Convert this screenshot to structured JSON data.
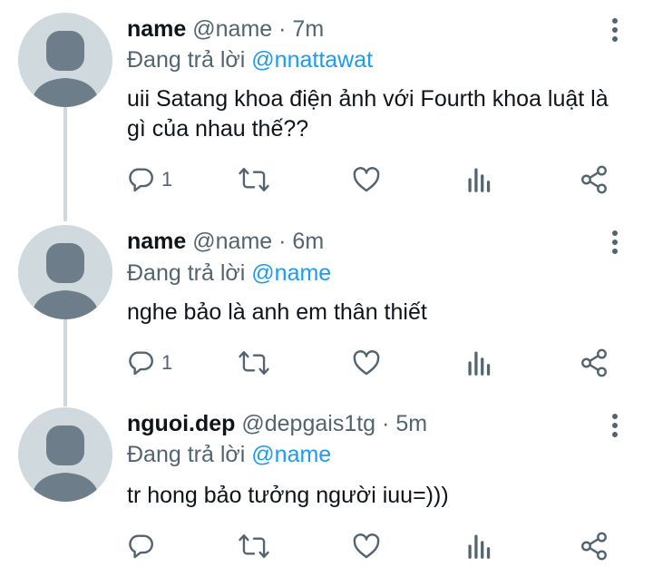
{
  "tweets": [
    {
      "name": "name",
      "handle": "@name",
      "time": "7m",
      "replying_prefix": "Đang trả lời",
      "replying_to": "@nnattawat",
      "text": "uii Satang khoa điện ảnh với Fourth khoa luật là gì của nhau thế??",
      "reply_count": "1"
    },
    {
      "name": "name",
      "handle": "@name",
      "time": "6m",
      "replying_prefix": "Đang trả lời",
      "replying_to": "@name",
      "text": "nghe bảo là anh em thân thiết",
      "reply_count": "1"
    },
    {
      "name": "nguoi.dep",
      "handle": "@depgais1tg",
      "time": "5m",
      "replying_prefix": "Đang trả lời",
      "replying_to": "@name",
      "text": "tr hong bảo tưởng người iuu=)))",
      "reply_count": ""
    }
  ],
  "separator": "·",
  "icons": {
    "reply": "reply-icon",
    "retweet": "retweet-icon",
    "like": "heart-icon",
    "views": "analytics-icon",
    "share": "share-icon",
    "more": "more-vertical-icon"
  },
  "colors": {
    "text": "#0f1419",
    "secondary": "#536471",
    "link": "#1d9bf0",
    "avatar_bg": "#cfd9de",
    "avatar_fg": "#6e7d8a"
  }
}
